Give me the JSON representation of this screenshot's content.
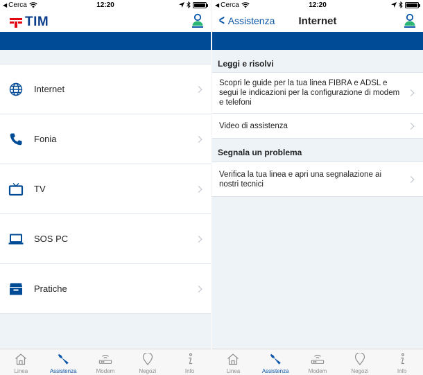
{
  "status_bar": {
    "carrier": "Cerca",
    "time": "12:20"
  },
  "left": {
    "logo": "TIM",
    "menu": [
      {
        "label": "Internet",
        "icon": "globe-icon"
      },
      {
        "label": "Fonia",
        "icon": "phone-icon"
      },
      {
        "label": "TV",
        "icon": "tv-icon"
      },
      {
        "label": "SOS PC",
        "icon": "laptop-icon"
      },
      {
        "label": "Pratiche",
        "icon": "archive-box-icon"
      }
    ]
  },
  "right": {
    "back_label": "Assistenza",
    "title": "Internet",
    "sections": [
      {
        "header": "Leggi e risolvi",
        "items": [
          "Scopri le guide per la tua linea FIBRA e ADSL e segui le indicazioni per la configurazione di modem e telefoni",
          "Video di assistenza"
        ]
      },
      {
        "header": "Segnala un problema",
        "items": [
          "Verifica la tua linea e apri una segnalazione ai nostri tecnici"
        ]
      }
    ]
  },
  "tabbar": {
    "active": "Assistenza",
    "tabs": [
      {
        "label": "Linea",
        "icon": "home-icon"
      },
      {
        "label": "Assistenza",
        "icon": "wrench-icon"
      },
      {
        "label": "Modem",
        "icon": "modem-icon"
      },
      {
        "label": "Negozi",
        "icon": "map-pin-icon"
      },
      {
        "label": "Info",
        "icon": "info-icon"
      }
    ]
  },
  "colors": {
    "brand_blue": "#004b95",
    "link_blue": "#0a56a8",
    "tim_red": "#e30613",
    "tim_navy": "#0a3e8c",
    "background": "#eef3f8"
  }
}
